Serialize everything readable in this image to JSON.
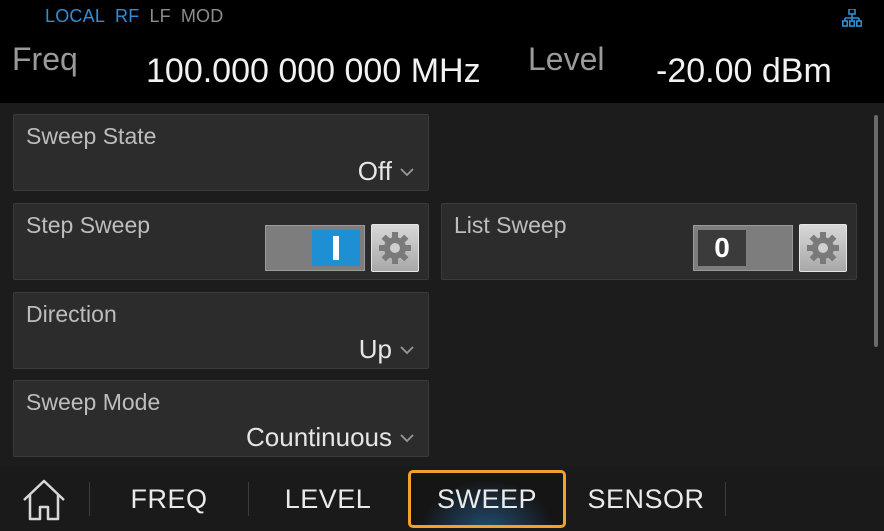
{
  "status": {
    "local": "LOCAL",
    "rf": "RF",
    "lf": "LF",
    "mod": "MOD",
    "icon": "network-icon"
  },
  "header": {
    "freq_label": "Freq",
    "freq_value": "100.000 000 000 MHz",
    "level_label": "Level",
    "level_value": "-20.00  dBm"
  },
  "panels": {
    "sweep_state": {
      "title": "Sweep State",
      "value": "Off"
    },
    "step_sweep": {
      "title": "Step Sweep",
      "toggle": "on"
    },
    "list_sweep": {
      "title": "List Sweep",
      "toggle": "off",
      "toggle_text": "0"
    },
    "direction": {
      "title": "Direction",
      "value": "Up"
    },
    "sweep_mode": {
      "title": "Sweep Mode",
      "value": "Countinuous"
    }
  },
  "nav": {
    "home_icon": "home-icon",
    "tabs": [
      {
        "label": "FREQ",
        "active": false
      },
      {
        "label": "LEVEL",
        "active": false
      },
      {
        "label": "SWEEP",
        "active": true
      },
      {
        "label": "SENSOR",
        "active": false
      }
    ]
  },
  "colors": {
    "accent_blue": "#1f8fd4",
    "active_tab_border": "#f2a12a",
    "background": "#000000",
    "panel": "#2c2c2c"
  }
}
